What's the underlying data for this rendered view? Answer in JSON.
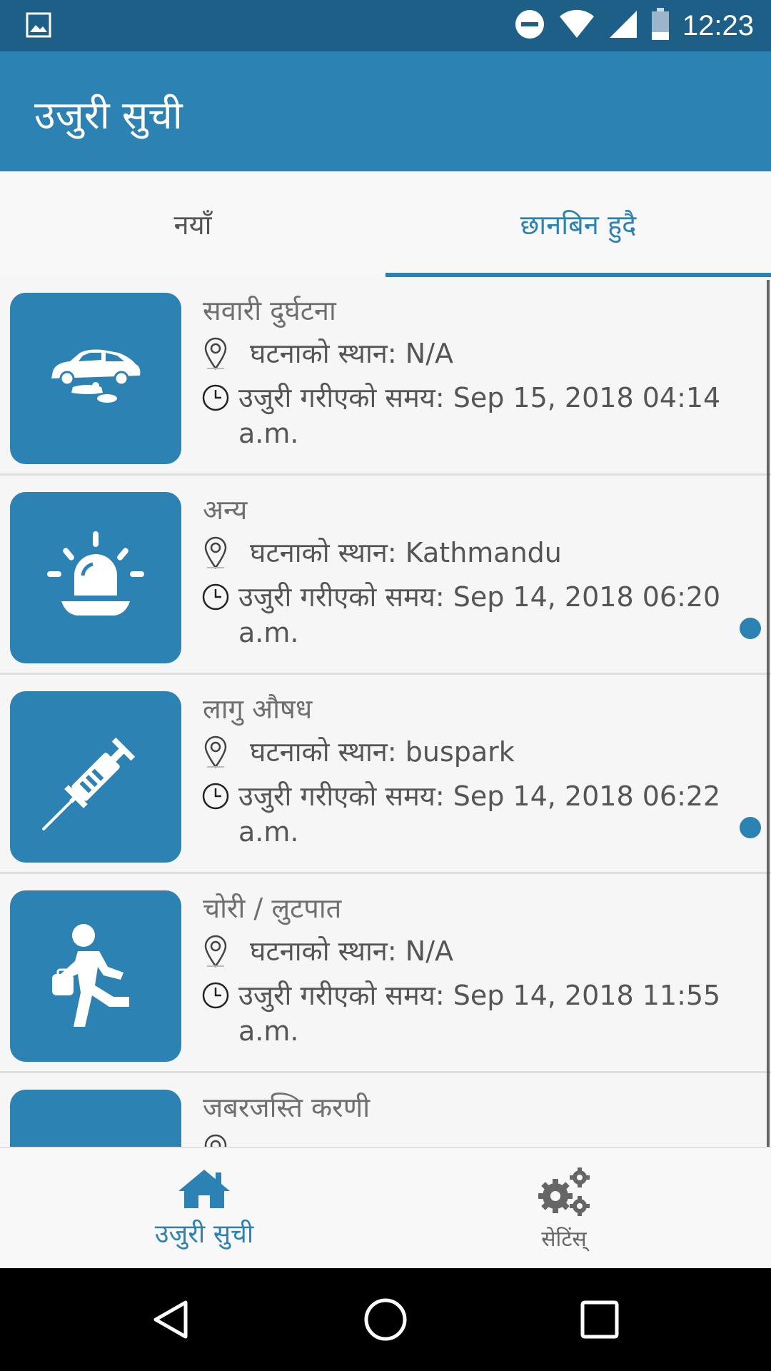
{
  "status_bar": {
    "time": "12:23",
    "icons": [
      "image-icon",
      "do-not-disturb-icon",
      "wifi-icon",
      "signal-icon",
      "battery-icon"
    ]
  },
  "app_bar": {
    "title": "उजुरी सुची"
  },
  "tabs": [
    {
      "label": "नयाँ",
      "active": false
    },
    {
      "label": "छानबिन हुदै",
      "active": true
    }
  ],
  "complaints": [
    {
      "category": "सवारी दुर्घटना",
      "icon": "car-accident-icon",
      "location": "घटनाको स्थान: N/A",
      "time": "उजुरी गरीएको समय: Sep 15, 2018 04:14 a.m.",
      "unread": false
    },
    {
      "category": "अन्य",
      "icon": "siren-icon",
      "location": "घटनाको स्थान: Kathmandu",
      "time": "उजुरी गरीएको समय: Sep 14, 2018 06:20 a.m.",
      "unread": true
    },
    {
      "category": "लागु औषध",
      "icon": "syringe-icon",
      "location": "घटनाको स्थान: buspark",
      "time": "उजुरी गरीएको समय: Sep 14, 2018 06:22 a.m.",
      "unread": true
    },
    {
      "category": "चोरी / लुटपात",
      "icon": "thief-running-icon",
      "location": "घटनाको स्थान: N/A",
      "time": "उजुरी गरीएको समय: Sep 14, 2018 11:55 a.m.",
      "unread": false
    },
    {
      "category": "जबरजस्ति करणी",
      "icon": "assault-icon",
      "location": "",
      "time": "",
      "unread": false
    }
  ],
  "bottom_nav": [
    {
      "label": "उजुरी सुची",
      "icon": "home-icon",
      "active": true
    },
    {
      "label": "सेटिंस्",
      "icon": "gears-icon",
      "active": false
    }
  ],
  "colors": {
    "primary": "#2b82b3",
    "status_bar": "#1e5f87",
    "text": "#555555"
  }
}
